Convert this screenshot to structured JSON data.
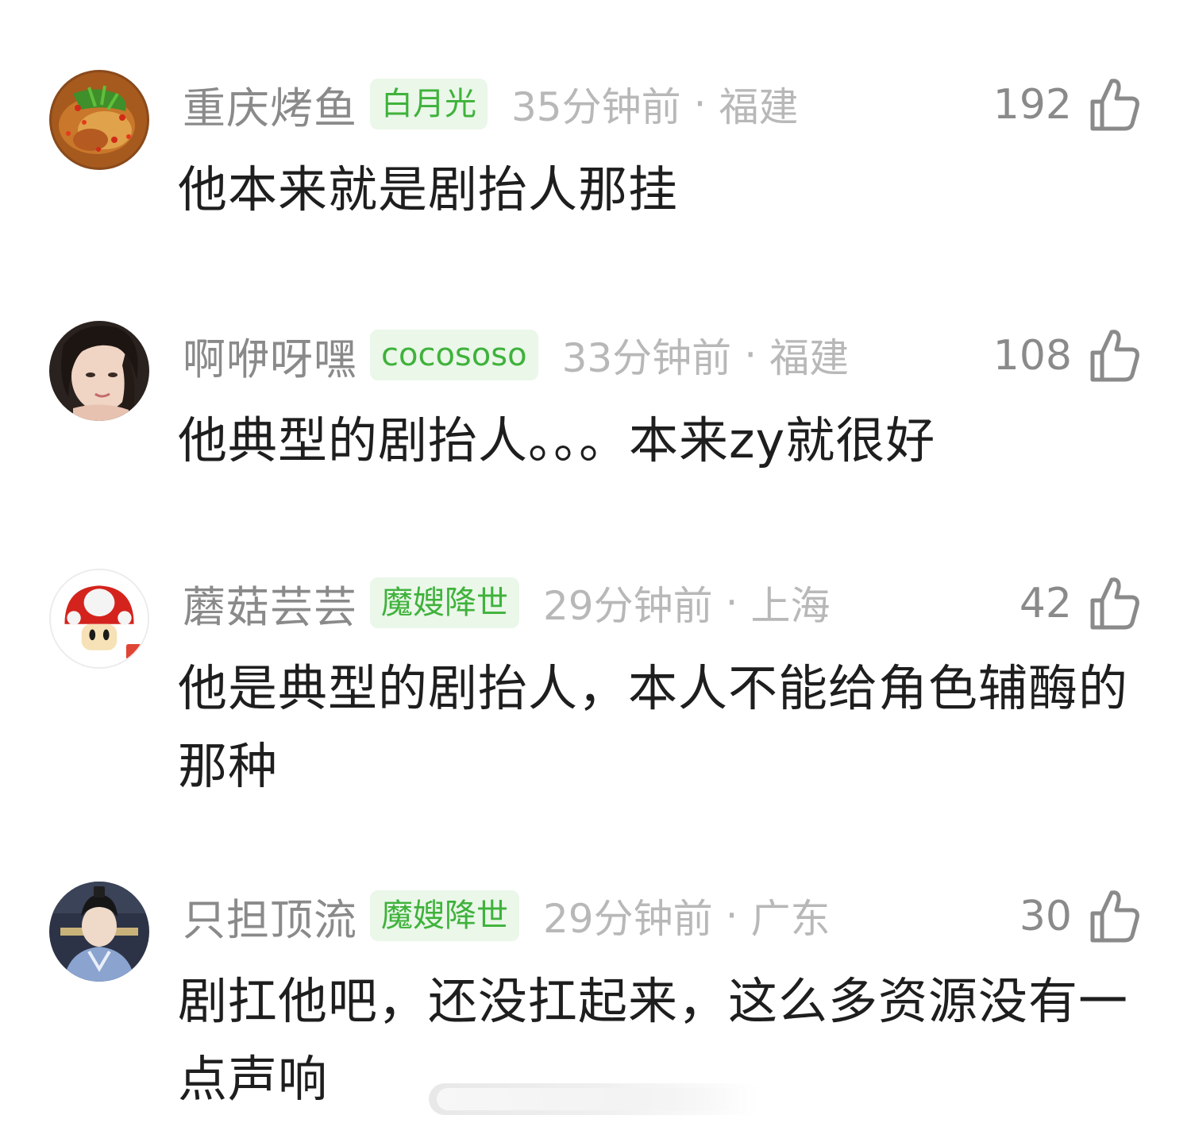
{
  "comments": [
    {
      "username": "重庆烤鱼",
      "badge": "白月光",
      "time": "35分钟前",
      "separator": "·",
      "location": "福建",
      "likes": "192",
      "text": "他本来就是剧抬人那挂",
      "avatar_icon": "grilled-fish-avatar"
    },
    {
      "username": "啊咿呀嘿",
      "badge": "cocososo",
      "time": "33分钟前",
      "separator": "·",
      "location": "福建",
      "likes": "108",
      "text": "他典型的剧抬人。。。本来zy就很好",
      "avatar_icon": "girl-portrait-avatar"
    },
    {
      "username": "蘑菇芸芸",
      "badge": "魔嫂降世",
      "time": "29分钟前",
      "separator": "·",
      "location": "上海",
      "likes": "42",
      "text": "他是典型的剧抬人，本人不能给角色辅酶的那种",
      "avatar_icon": "mushroom-avatar"
    },
    {
      "username": "只担顶流",
      "badge": "魔嫂降世",
      "time": "29分钟前",
      "separator": "·",
      "location": "广东",
      "likes": "30",
      "text": "剧扛他吧，还没扛起来，这么多资源没有一点声响",
      "avatar_icon": "costume-actor-avatar"
    }
  ],
  "colors": {
    "username": "#8a8a8a",
    "badge_bg": "#eaf7e9",
    "badge_text": "#3fb23b",
    "meta": "#b8b8b8",
    "body_text": "#1e1e1e"
  },
  "icons": {
    "like": "thumbs-up-icon"
  }
}
